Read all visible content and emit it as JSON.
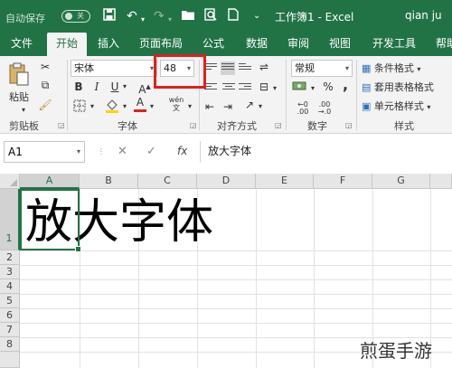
{
  "title_bar": {
    "autosave_label": "自动保存",
    "autosave_state": "关",
    "document_title": "工作簿1 - Excel",
    "user": "qian ju",
    "icons": [
      "save-icon",
      "undo-icon",
      "redo-icon",
      "open-folder-icon",
      "print-preview-icon",
      "new-document-icon",
      "customize-toolbar-icon"
    ]
  },
  "tabs": [
    "文件",
    "开始",
    "插入",
    "页面布局",
    "公式",
    "数据",
    "审阅",
    "视图",
    "开发工具",
    "帮助"
  ],
  "active_tab": "开始",
  "ribbon": {
    "clipboard": {
      "paste_label": "粘贴",
      "group_label": "剪贴板"
    },
    "font": {
      "font_name": "宋体",
      "font_size": "48",
      "bold": "B",
      "italic": "I",
      "underline": "U",
      "font_color_letter": "A",
      "phonetic": "wén",
      "group_label": "字体"
    },
    "alignment": {
      "group_label": "对齐方式"
    },
    "number": {
      "format": "常规",
      "percent": "%",
      "comma": ",",
      "group_label": "数字"
    },
    "styles": {
      "conditional_format": "条件格式",
      "table_format": "套用表格格式",
      "cell_styles": "单元格样式",
      "group_label": "样式"
    }
  },
  "formula_bar": {
    "name_box": "A1",
    "cancel": "✕",
    "enter": "✓",
    "fx": "fx",
    "content": "放大字体"
  },
  "grid": {
    "columns": [
      "A",
      "B",
      "C",
      "D",
      "E",
      "F",
      "G"
    ],
    "rows": [
      "1",
      "2",
      "3",
      "4",
      "5",
      "6",
      "7",
      "8"
    ],
    "cell_A1": "放大字体",
    "selected_cell": "A1"
  },
  "watermark": "煎蛋手游",
  "colors": {
    "accent": "#217346",
    "highlight": "#e0201b"
  }
}
